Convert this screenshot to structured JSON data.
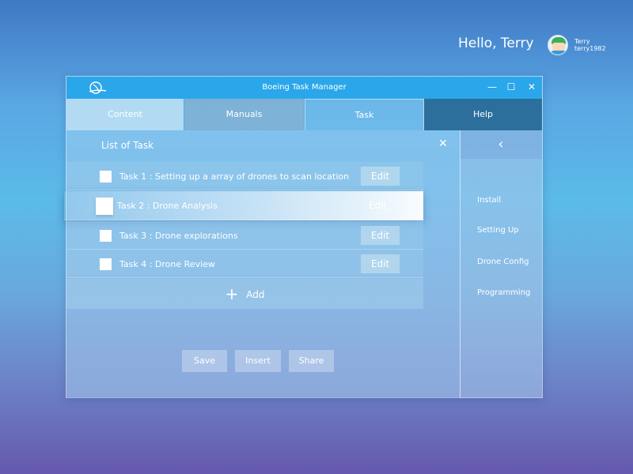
{
  "user": {
    "greeting": "Hello, Terry",
    "name": "Terry",
    "handle": "terry1982"
  },
  "window": {
    "title": "Boeing Task Manager",
    "controls": {
      "minimize": "—",
      "maximize": "☐",
      "close": "✕"
    }
  },
  "tabs": [
    {
      "label": "Content"
    },
    {
      "label": "Manuals"
    },
    {
      "label": "Task"
    },
    {
      "label": "Help"
    }
  ],
  "help": {
    "back": "‹",
    "items": [
      "Install",
      "Setting Up",
      "Drone Config",
      "Programming"
    ]
  },
  "task_panel": {
    "title": "List of Task",
    "close": "✕",
    "tasks": [
      {
        "label": "Task 1 : Setting up a array of drones to scan location",
        "edit": "Edit"
      },
      {
        "label": "Task 2 : Drone Analysis",
        "edit": "Edit"
      },
      {
        "label": "Task 3 : Drone explorations",
        "edit": "Edit"
      },
      {
        "label": "Task 4 : Drone Review",
        "edit": "Edit"
      }
    ],
    "add": {
      "icon": "+",
      "label": "Add"
    },
    "actions": {
      "save": "Save",
      "insert": "Insert",
      "share": "Share"
    }
  },
  "colors": {
    "titlebar": "#2aa7ea",
    "help_tab": "#2c6f9c"
  }
}
